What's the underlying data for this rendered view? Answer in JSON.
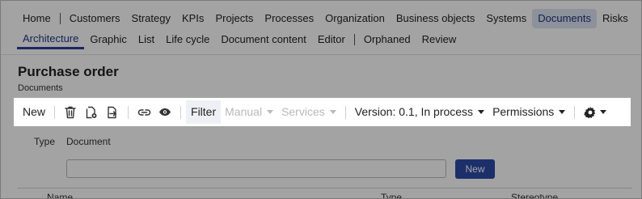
{
  "nav": {
    "primary": [
      "Home",
      "Customers",
      "Strategy",
      "KPIs",
      "Projects",
      "Processes",
      "Organization",
      "Business objects",
      "Systems",
      "Documents",
      "Risks"
    ],
    "secondary": [
      "Architecture",
      "Graphic",
      "List",
      "Life cycle",
      "Document content",
      "Editor",
      "Orphaned",
      "Review"
    ]
  },
  "page": {
    "title": "Purchase order",
    "subtitle": "Documents"
  },
  "toolbar": {
    "new_label": "New",
    "filter_label": "Filter",
    "manual_label": "Manual",
    "services_label": "Services",
    "version_label": "Version: 0.1, In process",
    "permissions_label": "Permissions"
  },
  "form": {
    "type_label": "Type",
    "type_value": "Document",
    "input_value": "",
    "new_button_label": "New"
  },
  "table": {
    "columns": [
      "Name",
      "Type",
      "Stereotype"
    ]
  },
  "colors": {
    "accent": "#2c4aa8",
    "active_pill": "#dde3f3",
    "overlay": "rgba(0,0,0,0.36)"
  }
}
